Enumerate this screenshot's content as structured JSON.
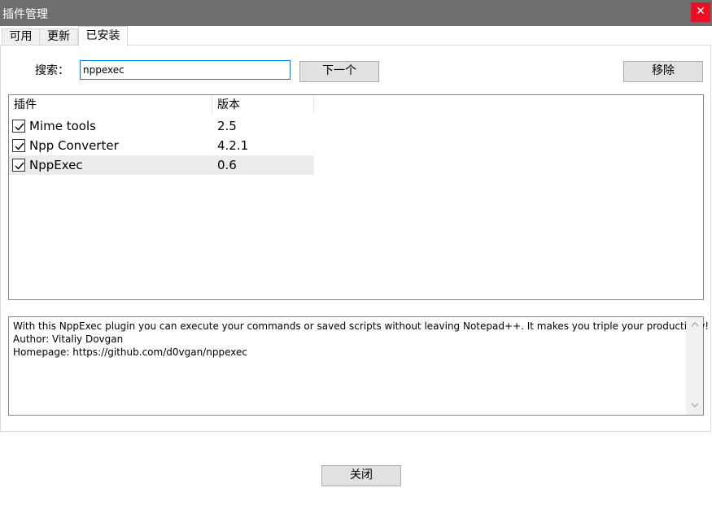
{
  "window": {
    "title": "插件管理",
    "close_glyph": "✕"
  },
  "tabs": [
    {
      "label": "可用"
    },
    {
      "label": "更新"
    },
    {
      "label": "已安装"
    }
  ],
  "search": {
    "label": "搜索：",
    "value": "nppexec"
  },
  "buttons": {
    "next": "下一个",
    "remove": "移除",
    "close": "关闭"
  },
  "list": {
    "columns": [
      "插件",
      "版本"
    ],
    "rows": [
      {
        "name": "Mime tools",
        "version": "2.5",
        "checked": true
      },
      {
        "name": "Npp Converter",
        "version": "4.2.1",
        "checked": true
      },
      {
        "name": "NppExec",
        "version": "0.6",
        "checked": true,
        "selected": true
      }
    ]
  },
  "description": {
    "lines": [
      "With this NppExec plugin you can execute your commands or saved scripts without leaving Notepad++. It makes you triple your productivity!",
      "Author: Vitaliy Dovgan",
      "Homepage: https://github.com/d0vgan/nppexec"
    ]
  },
  "colors": {
    "titlebar": "#6e6e6e",
    "close_button": "#e81123",
    "input_focus": "#0078d7"
  }
}
